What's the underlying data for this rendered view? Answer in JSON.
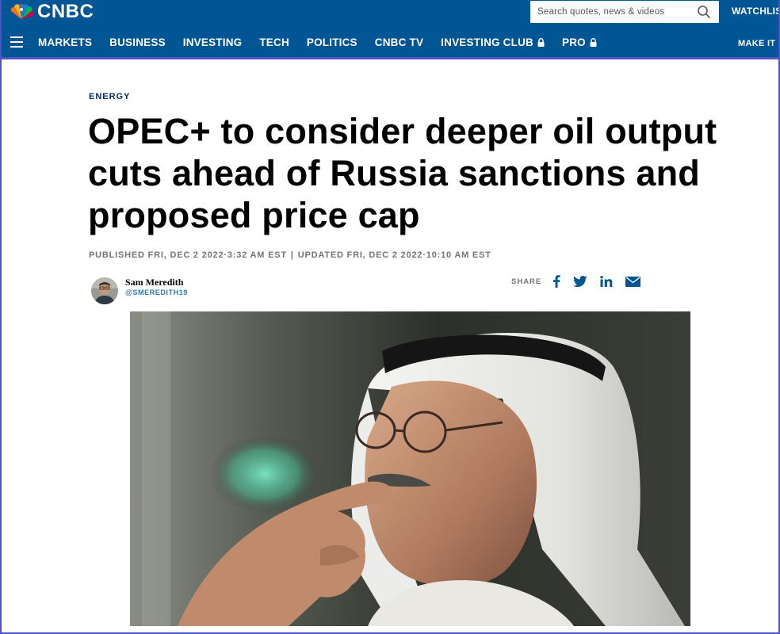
{
  "brand": {
    "name": "CNBC"
  },
  "search": {
    "placeholder": "Search quotes, news & videos"
  },
  "header": {
    "watchlist_label": "WATCHLIS",
    "make_it_label": "MAKE IT"
  },
  "nav": {
    "items": [
      {
        "label": "MARKETS",
        "locked": false
      },
      {
        "label": "BUSINESS",
        "locked": false
      },
      {
        "label": "INVESTING",
        "locked": false
      },
      {
        "label": "TECH",
        "locked": false
      },
      {
        "label": "POLITICS",
        "locked": false
      },
      {
        "label": "CNBC TV",
        "locked": false
      },
      {
        "label": "INVESTING CLUB",
        "locked": true
      },
      {
        "label": "PRO",
        "locked": true
      }
    ]
  },
  "article": {
    "category": "ENERGY",
    "headline": "OPEC+ to consider deeper oil output cuts ahead of Russia sanctions and proposed price cap",
    "published": "PUBLISHED FRI, DEC 2 2022·3:32 AM EST",
    "separator": "|",
    "updated": "UPDATED FRI, DEC 2 2022·10:10 AM EST",
    "author": {
      "name": "Sam Meredith",
      "handle": "@SMEREDITH19"
    },
    "share": {
      "label": "SHARE",
      "icons": [
        "facebook-icon",
        "twitter-icon",
        "linkedin-icon",
        "email-icon"
      ]
    }
  },
  "colors": {
    "header_bg": "#005594",
    "accent_rule": "#4e55c7",
    "category_text": "#002f6c",
    "share_icon": "#005594"
  }
}
